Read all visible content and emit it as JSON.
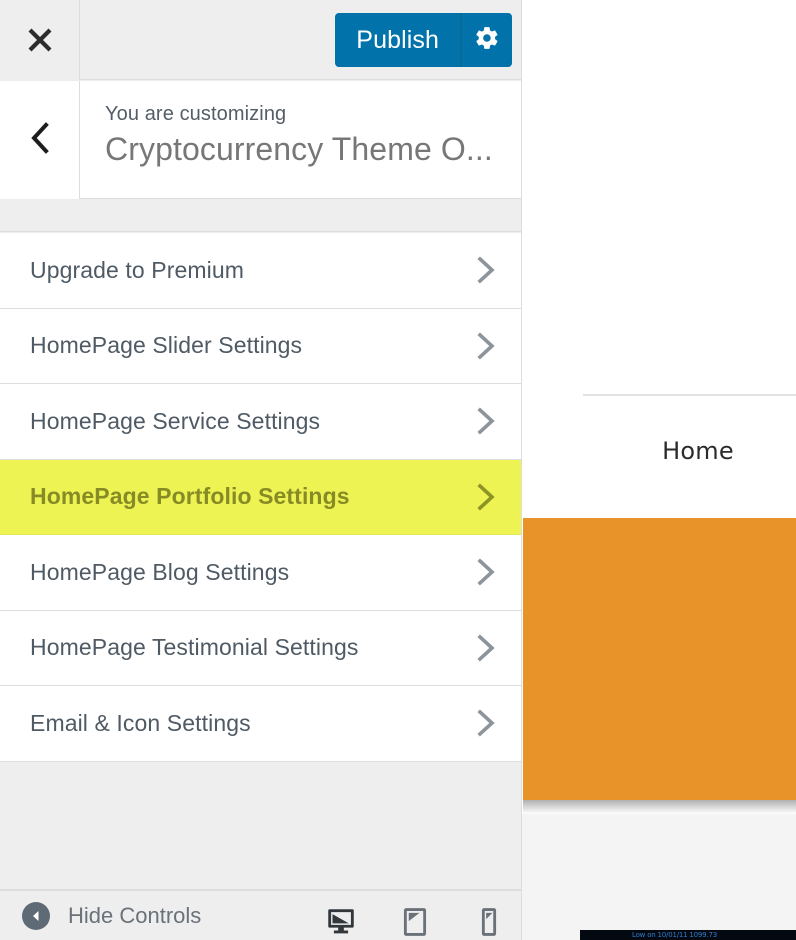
{
  "topbar": {
    "close_icon": "close-icon",
    "publish_label": "Publish",
    "publish_settings_icon": "gear-icon",
    "accent_color": "#0273aa"
  },
  "header": {
    "back_icon": "chevron-left-icon",
    "eyebrow": "You are customizing",
    "title": "Cryptocurrency Theme O..."
  },
  "sections": [
    {
      "label": "Upgrade to Premium",
      "chevron_icon": "chevron-right-icon",
      "active": false
    },
    {
      "label": "HomePage Slider Settings",
      "chevron_icon": "chevron-right-icon",
      "active": false
    },
    {
      "label": "HomePage Service Settings",
      "chevron_icon": "chevron-right-icon",
      "active": false
    },
    {
      "label": "HomePage Portfolio Settings",
      "chevron_icon": "chevron-right-icon",
      "active": true
    },
    {
      "label": "HomePage Blog Settings",
      "chevron_icon": "chevron-right-icon",
      "active": false
    },
    {
      "label": "HomePage Testimonial Settings",
      "chevron_icon": "chevron-right-icon",
      "active": false
    },
    {
      "label": "Email & Icon Settings",
      "chevron_icon": "chevron-right-icon",
      "active": false
    }
  ],
  "highlight": {
    "background_color": "#eef354",
    "text_color": "#878b25"
  },
  "footer": {
    "collapse_icon": "collapse-left-arrow-icon",
    "collapse_label": "Hide Controls",
    "devices": [
      {
        "name": "desktop",
        "icon": "desktop-icon",
        "active": true
      },
      {
        "name": "tablet",
        "icon": "tablet-icon",
        "active": false
      },
      {
        "name": "mobile",
        "icon": "mobile-icon",
        "active": false
      }
    ]
  },
  "preview": {
    "nav_link": "Home",
    "hero_color": "#e8922a",
    "ticker_text": "Low on 10/01/11  1099.73"
  }
}
